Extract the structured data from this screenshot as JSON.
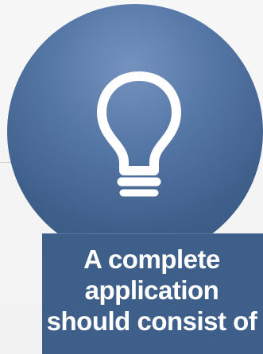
{
  "slide": {
    "caption": "A complete\napplication\nshould consist of",
    "icon": "lightbulb-icon",
    "colors": {
      "background": "#f4f4f4",
      "circle": "#4b6c9b",
      "caption_box": "#3f5f8b",
      "text": "#ffffff"
    }
  }
}
